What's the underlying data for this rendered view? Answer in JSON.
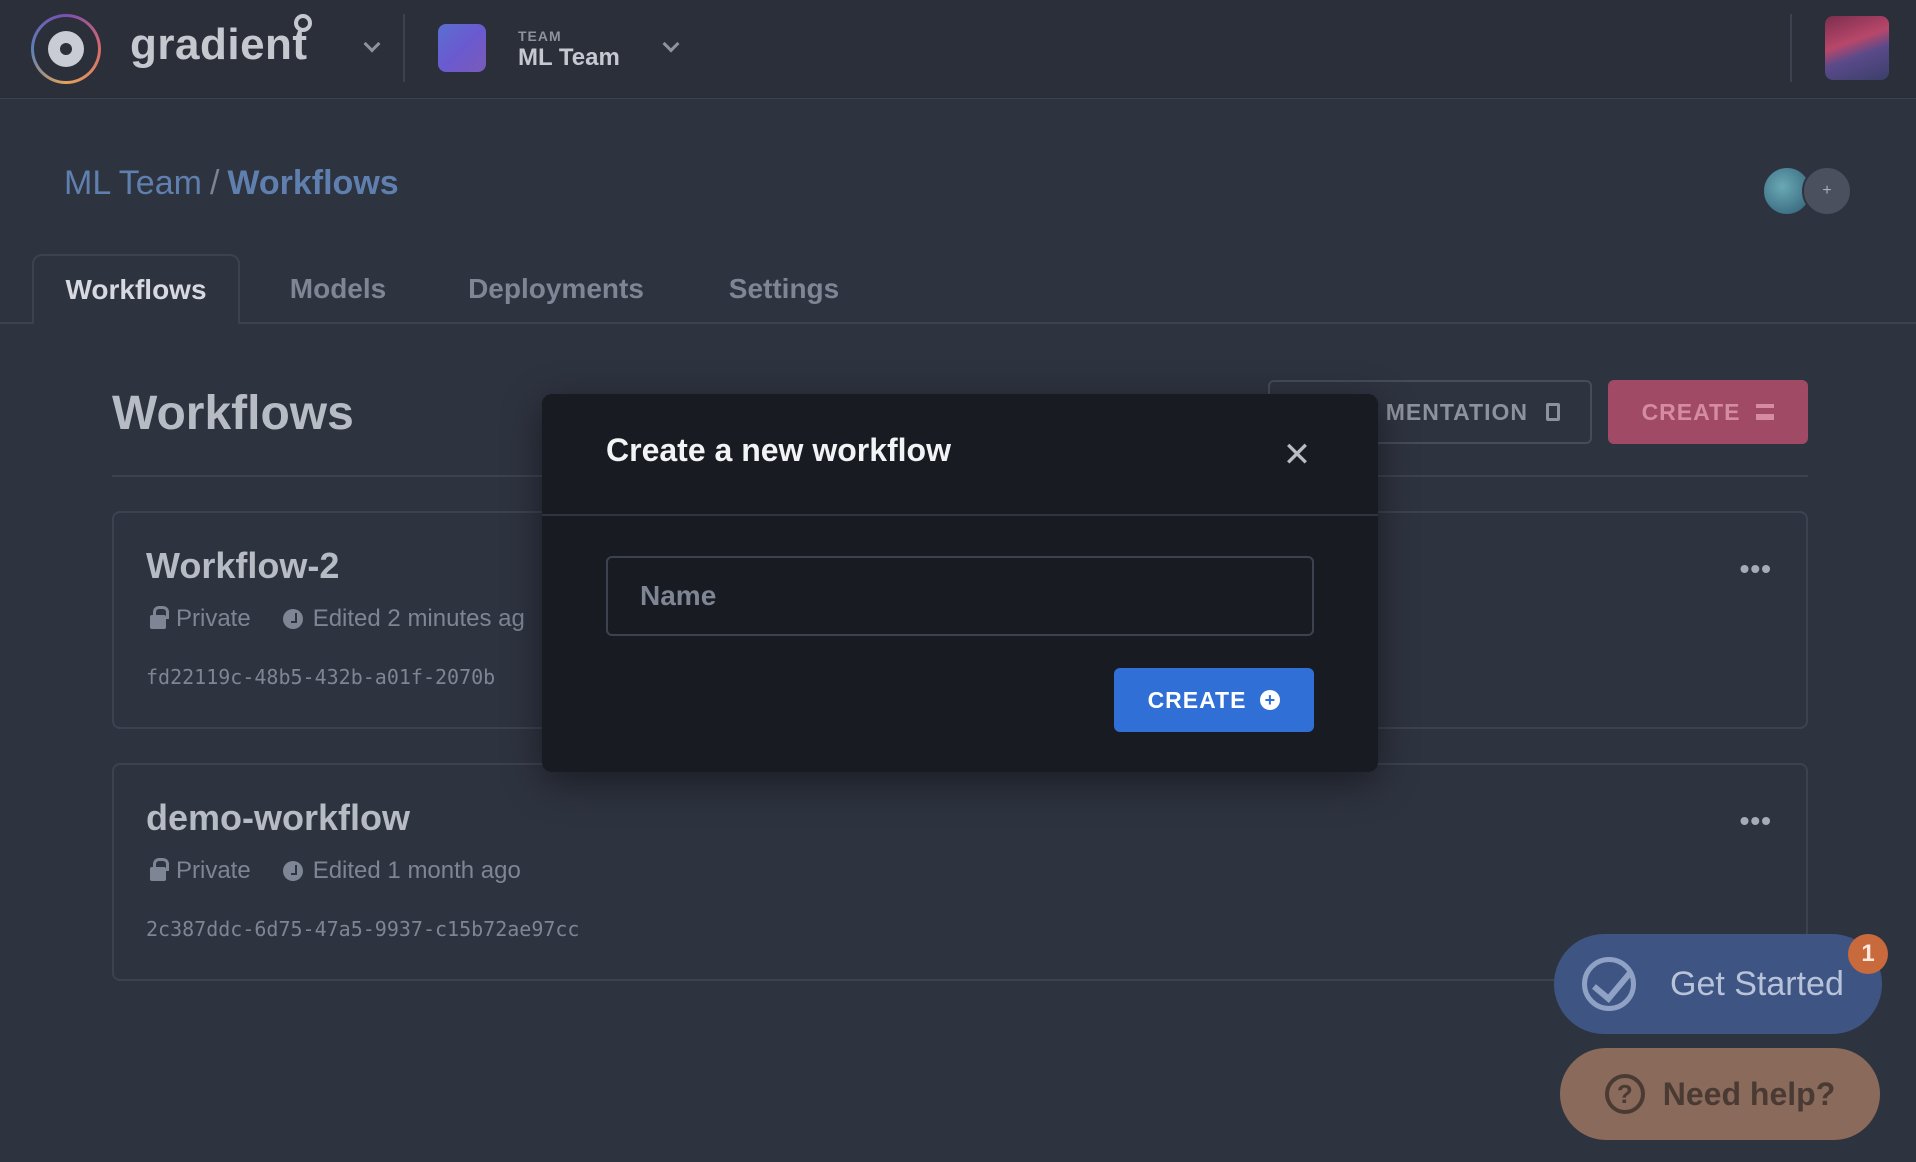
{
  "header": {
    "brand": "gradient",
    "team_kicker": "TEAM",
    "team_name": "ML Team"
  },
  "breadcrumb": {
    "team": "ML Team",
    "separator": "/",
    "current": "Workflows"
  },
  "collaborators": {
    "add_symbol": "+"
  },
  "tabs": [
    {
      "label": "Workflows",
      "active": true
    },
    {
      "label": "Models",
      "active": false
    },
    {
      "label": "Deployments",
      "active": false
    },
    {
      "label": "Settings",
      "active": false
    }
  ],
  "page": {
    "title": "Workflows",
    "docs_button_visible_label": "MENTATION",
    "create_button_label": "CREATE"
  },
  "workflows": [
    {
      "name": "Workflow-2",
      "visibility": "Private",
      "edited": "Edited 2 minutes ag",
      "id": "fd22119c-48b5-432b-a01f-2070b",
      "menu": "•••"
    },
    {
      "name": "demo-workflow",
      "visibility": "Private",
      "edited": "Edited 1 month ago",
      "id": "2c387ddc-6d75-47a5-9937-c15b72ae97cc",
      "menu": "•••"
    }
  ],
  "modal": {
    "title": "Create a new workflow",
    "close_symbol": "✕",
    "name_placeholder": "Name",
    "name_value": "",
    "create_label": "CREATE",
    "create_symbol": "+"
  },
  "widgets": {
    "get_started_label": "Get Started",
    "get_started_badge": "1",
    "need_help_label": "Need help?",
    "need_help_symbol": "?"
  },
  "colors": {
    "background": "#2e3340",
    "modal_bg": "#181b22",
    "primary_blue": "#2f6fd6",
    "create_pink": "#a04a66",
    "breadcrumb_blue": "#5f7fae"
  }
}
